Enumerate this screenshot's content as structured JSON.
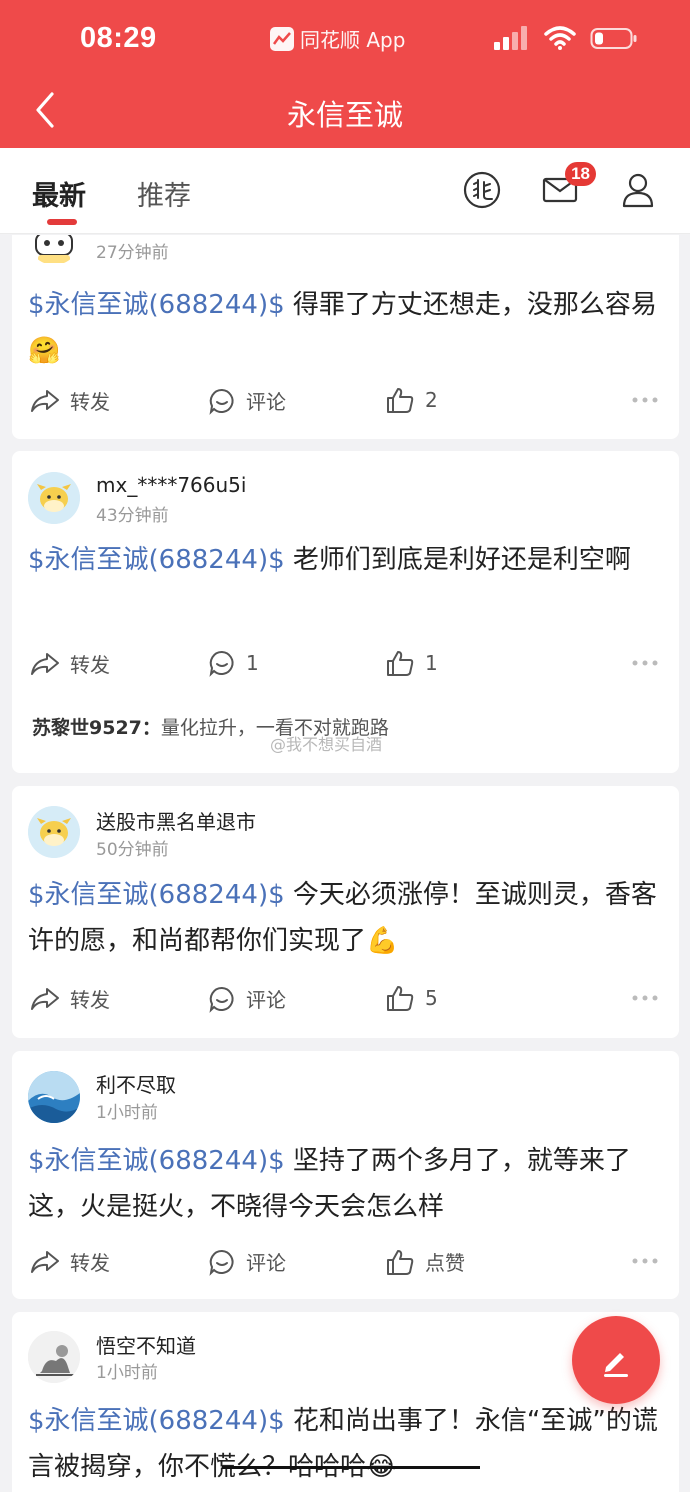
{
  "status_bar": {
    "time": "08:29",
    "app_label": "同花顺 App"
  },
  "nav": {
    "title": "永信至诚"
  },
  "tabs": {
    "latest": "最新",
    "recommend": "推荐"
  },
  "inbox": {
    "badge_count": "18"
  },
  "colors": {
    "brand_red": "#ef4a4a",
    "stock_link": "#4a71b8"
  },
  "posts": [
    {
      "time": "27分钟前",
      "stock_tag": "$永信至诚(688244)$",
      "text": " 得罪了方丈还想走，没那么容易",
      "emoji": "🤗",
      "share_label": "转发",
      "comment_label": "评论",
      "like_label": "2"
    },
    {
      "username": "mx_****766u5i",
      "time": "43分钟前",
      "stock_tag": "$永信至诚(688244)$",
      "text": " 老师们到底是利好还是利空啊",
      "share_label": "转发",
      "comment_label": "1",
      "like_label": "1",
      "reply_author": "苏黎世9527：",
      "reply_text": "量化拉升，一看不对就跑路"
    },
    {
      "username": "送股市黑名单退市",
      "time": "50分钟前",
      "stock_tag": "$永信至诚(688244)$",
      "text": " 今天必须涨停！至诚则灵，香客许的愿，和尚都帮你们实现了",
      "emoji": "💪",
      "share_label": "转发",
      "comment_label": "评论",
      "like_label": "5"
    },
    {
      "username": "利不尽取",
      "time": "1小时前",
      "stock_tag": "$永信至诚(688244)$",
      "text": " 坚持了两个多月了，就等来了这，火是挺火，不晓得今天会怎么样",
      "share_label": "转发",
      "comment_label": "评论",
      "like_label": "点赞"
    },
    {
      "username": "悟空不知道",
      "time": "1小时前",
      "stock_tag": "$永信至诚(688244)$",
      "text": " 花和尚出事了！永信“至诚”的谎言被揭穿，你不慌么？哈哈哈",
      "emoji": "😂"
    }
  ],
  "watermark": "@我不想买自酒"
}
